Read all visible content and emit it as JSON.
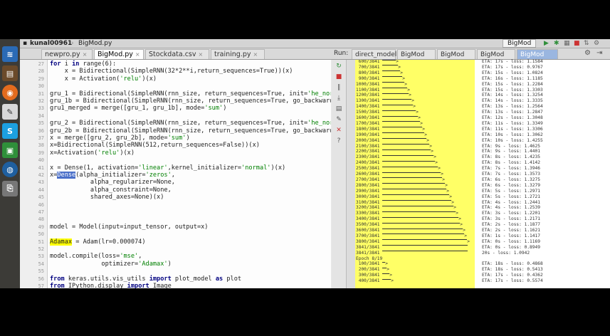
{
  "titlebar": {
    "user": "kunal00961",
    "file": "BigMod.py",
    "run_config": "BigMod"
  },
  "editor_tabs": [
    {
      "label": "newpro.py",
      "active": false
    },
    {
      "label": "BigMod.py",
      "active": true
    },
    {
      "label": "Stockdata.csv",
      "active": false
    },
    {
      "label": "training.py",
      "active": false
    }
  ],
  "run_panel": {
    "label": "Run:",
    "tabs": [
      {
        "label": "direct_model",
        "active": false
      },
      {
        "label": "BigMod",
        "active": false
      },
      {
        "label": "BigMod",
        "active": false
      },
      {
        "label": "BigMod",
        "active": false
      },
      {
        "label": "BigMod",
        "active": true
      }
    ]
  },
  "line_numbers": [
    "27",
    "28",
    "29",
    "30",
    "31",
    "32",
    "33",
    "34",
    "35",
    "36",
    "37",
    "38",
    "39",
    "40",
    "41",
    "42",
    "43",
    "44",
    "45",
    "46",
    "47",
    "48",
    "49",
    "50",
    "51",
    "52",
    "53",
    "54",
    "55",
    "56",
    "57",
    "58",
    "59",
    "60",
    "61",
    "62"
  ],
  "code_lines": [
    "for i in range(6):",
    "    x = Bidirectional(SimpleRNN(32*2**i,return_sequences=True))(x)",
    "    x = Activation('relu')(x)",
    "",
    "gru_1 = Bidirectional(SimpleRNN(rnn_size, return_sequences=True, init='he_norma",
    "gru_1b = Bidirectional(SimpleRNN(rnn_size, return_sequences=True, go_backwards=",
    "gru1_merged = merge([gru_1, gru_1b], mode='sum')",
    "",
    "gru_2 = Bidirectional(SimpleRNN(rnn_size, return_sequences=True, init='he_norma",
    "gru_2b = Bidirectional(SimpleRNN(rnn_size, return_sequences=True, go_backwards=",
    "x = merge([gru_2, gru_2b], mode='sum')",
    "x=Bidirectional(SimpleRNN(512,return_sequences=False))(x)",
    "x=Activation('relu')(x)",
    "",
    "x = Dense(1, activation='linear',kernel_initializer='normal')(x)",
    "x=Dense(alpha_initializer='zeros',",
    "           alpha_regularizer=None,",
    "           alpha_constraint=None,",
    "           shared_axes=None)(x)",
    "",
    "",
    "",
    "model = Model(input=input_tensor, output=x)",
    "",
    "Adamax = Adam(lr=0.000074)",
    "",
    "model.compile(loss='mse',",
    "              optimizer='Adamax')",
    "",
    "from keras.utils.vis_utils import plot_model as plot",
    "from IPython.display import Image"
  ],
  "console_lines": [
    {
      "step": "600/3841",
      "eta": "ETA: 17s - loss: 1.1584",
      "fill": 0.16
    },
    {
      "step": "700/3841",
      "eta": "ETA: 17s - loss: 0.9767",
      "fill": 0.18
    },
    {
      "step": "800/3841",
      "eta": "ETA: 15s - loss: 1.0824",
      "fill": 0.21
    },
    {
      "step": "900/3841",
      "eta": "ETA: 16s - loss: 1.1185",
      "fill": 0.23
    },
    {
      "step": "1000/3841",
      "eta": "ETA: 15s - loss: 1.2284",
      "fill": 0.26
    },
    {
      "step": "1100/3841",
      "eta": "ETA: 15s - loss: 1.3303",
      "fill": 0.29
    },
    {
      "step": "1200/3841",
      "eta": "ETA: 14s - loss: 1.3254",
      "fill": 0.31
    },
    {
      "step": "1300/3841",
      "eta": "ETA: 14s - loss: 1.3335",
      "fill": 0.34
    },
    {
      "step": "1400/3841",
      "eta": "ETA: 13s - loss: 1.2564",
      "fill": 0.36
    },
    {
      "step": "1500/3841",
      "eta": "ETA: 13s - loss: 1.2847",
      "fill": 0.39
    },
    {
      "step": "1600/3841",
      "eta": "ETA: 12s - loss: 1.3048",
      "fill": 0.42
    },
    {
      "step": "1700/3841",
      "eta": "ETA: 11s - loss: 1.3349",
      "fill": 0.44
    },
    {
      "step": "1800/3841",
      "eta": "ETA: 11s - loss: 1.3306",
      "fill": 0.47
    },
    {
      "step": "1900/3841",
      "eta": "ETA: 10s - loss: 1.3062",
      "fill": 0.49
    },
    {
      "step": "2000/3841",
      "eta": "ETA: 10s - loss: 1.4255",
      "fill": 0.52
    },
    {
      "step": "2100/3841",
      "eta": "ETA: 9s - loss: 1.4625",
      "fill": 0.55
    },
    {
      "step": "2200/3841",
      "eta": "ETA: 9s - loss: 1.4401",
      "fill": 0.57
    },
    {
      "step": "2300/3841",
      "eta": "ETA: 8s - loss: 1.4235",
      "fill": 0.6
    },
    {
      "step": "2400/3841",
      "eta": "ETA: 8s - loss: 1.4142",
      "fill": 0.62
    },
    {
      "step": "2500/3841",
      "eta": "ETA: 7s - loss: 1.3946",
      "fill": 0.65
    },
    {
      "step": "2600/3841",
      "eta": "ETA: 7s - loss: 1.3573",
      "fill": 0.68
    },
    {
      "step": "2700/3841",
      "eta": "ETA: 6s - loss: 1.3275",
      "fill": 0.7
    },
    {
      "step": "2800/3841",
      "eta": "ETA: 6s - loss: 1.3279",
      "fill": 0.73
    },
    {
      "step": "2900/3841",
      "eta": "ETA: 5s - loss: 1.2971",
      "fill": 0.75
    },
    {
      "step": "3000/3841",
      "eta": "ETA: 5s - loss: 1.2721",
      "fill": 0.78
    },
    {
      "step": "3100/3841",
      "eta": "ETA: 4s - loss: 1.2441",
      "fill": 0.81
    },
    {
      "step": "3200/3841",
      "eta": "ETA: 4s - loss: 1.2539",
      "fill": 0.83
    },
    {
      "step": "3300/3841",
      "eta": "ETA: 3s - loss: 1.2201",
      "fill": 0.86
    },
    {
      "step": "3400/3841",
      "eta": "ETA: 3s - loss: 1.2171",
      "fill": 0.89
    },
    {
      "step": "3500/3841",
      "eta": "ETA: 2s - loss: 1.1877",
      "fill": 0.91
    },
    {
      "step": "3600/3841",
      "eta": "ETA: 2s - loss: 1.1621",
      "fill": 0.94
    },
    {
      "step": "3700/3841",
      "eta": "ETA: 1s - loss: 1.1417",
      "fill": 0.96
    },
    {
      "step": "3800/3841",
      "eta": "ETA: 0s - loss: 1.1169",
      "fill": 0.99
    },
    {
      "step": "3841/3841",
      "eta": "ETA: 0s - loss: 0.8949",
      "fill": 1.0
    },
    {
      "step": "3841/3841",
      "eta": "20s - loss: 1.0942",
      "fill": 1.0
    },
    {
      "step": "Epoch 8/19",
      "eta": "",
      "fill": 0
    },
    {
      "step": "100/3841",
      "eta": "ETA: 18s - loss: 0.4868",
      "fill": 0.03
    },
    {
      "step": "200/3841",
      "eta": "ETA: 18s - loss: 0.5413",
      "fill": 0.05
    },
    {
      "step": "300/3841",
      "eta": "ETA: 17s - loss: 0.4362",
      "fill": 0.08
    },
    {
      "step": "400/3841",
      "eta": "ETA: 17s - loss: 0.5574",
      "fill": 0.1
    }
  ]
}
